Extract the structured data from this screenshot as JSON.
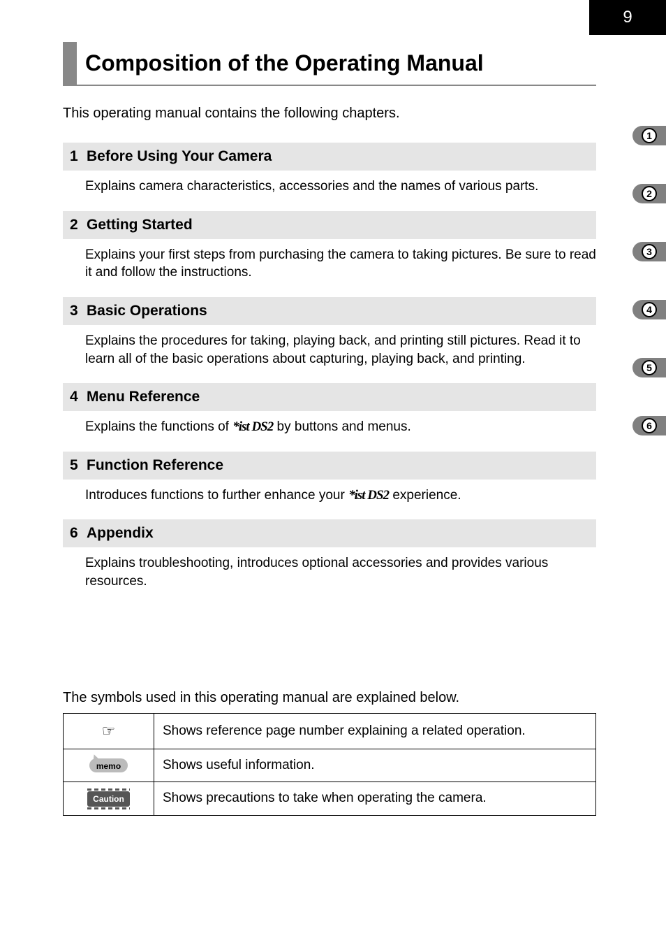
{
  "page_number": "9",
  "title": "Composition of the Operating Manual",
  "intro": "This operating manual contains the following chapters.",
  "chapters": [
    {
      "num": "1",
      "title": "Before Using Your Camera",
      "body": "Explains camera characteristics, accessories and the names of various parts."
    },
    {
      "num": "2",
      "title": "Getting Started",
      "body": "Explains your first steps from purchasing the camera to taking pictures. Be sure to read it and follow the instructions."
    },
    {
      "num": "3",
      "title": "Basic Operations",
      "body": "Explains the procedures for taking, playing back, and printing still pictures. Read it to learn all of the basic operations about capturing, playing back, and printing."
    },
    {
      "num": "4",
      "title": "Menu Reference",
      "body_prefix": "Explains the functions of ",
      "model": "*ist DS2",
      "body_suffix": " by buttons and menus."
    },
    {
      "num": "5",
      "title": "Function Reference",
      "body_prefix": "Introduces functions to further enhance your ",
      "model": "*ist DS2",
      "body_suffix": " experience."
    },
    {
      "num": "6",
      "title": "Appendix",
      "body": "Explains troubleshooting, introduces optional accessories and provides various resources."
    }
  ],
  "symbols_intro": "The symbols used in this operating manual are explained below.",
  "symbols": [
    {
      "icon": "hand",
      "glyph": "☞",
      "desc": "Shows reference page number explaining a related operation."
    },
    {
      "icon": "memo",
      "label": "memo",
      "desc": "Shows useful information."
    },
    {
      "icon": "caution",
      "label": "Caution",
      "desc": "Shows precautions to take when operating the camera."
    }
  ],
  "tabs": [
    "1",
    "2",
    "3",
    "4",
    "5",
    "6"
  ]
}
